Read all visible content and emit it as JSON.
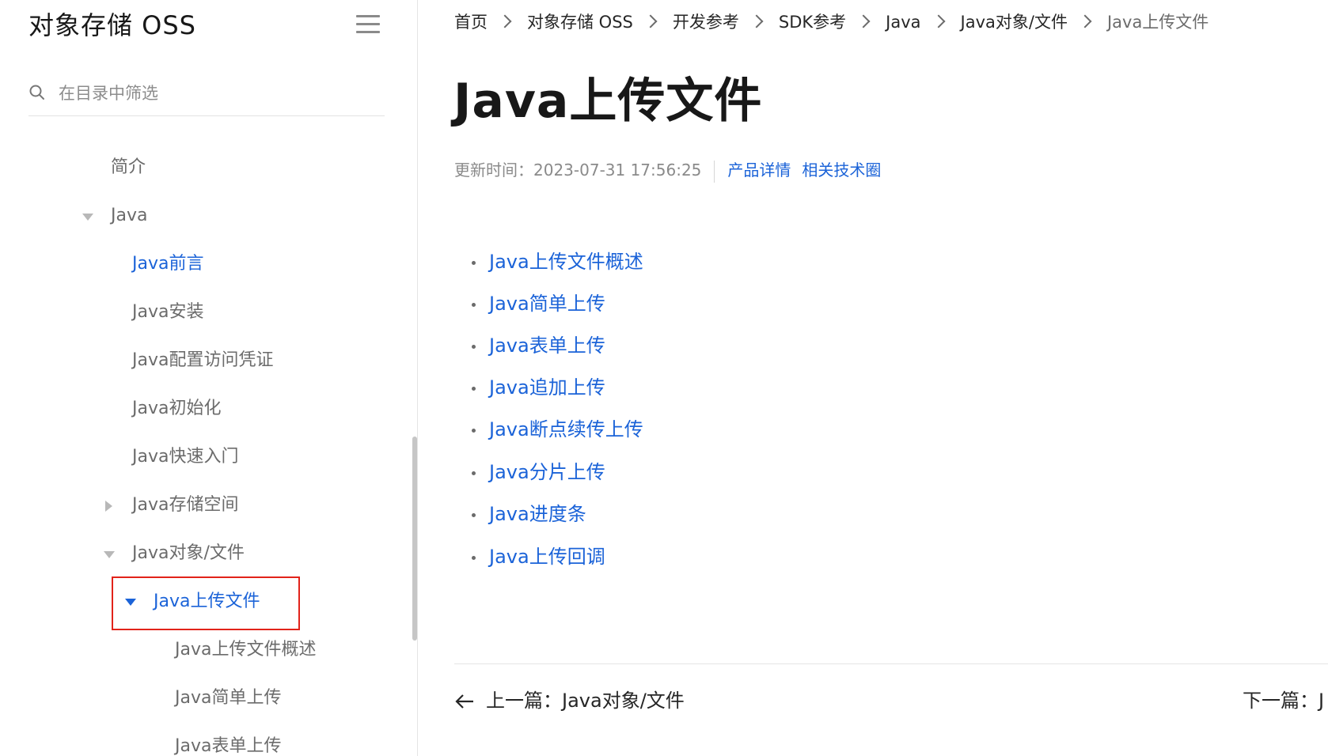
{
  "sidebar": {
    "title": "对象存储 OSS",
    "search_placeholder": "在目录中筛选",
    "items": [
      {
        "label": "简介"
      },
      {
        "label": "Java"
      },
      {
        "label": "Java前言"
      },
      {
        "label": "Java安装"
      },
      {
        "label": "Java配置访问凭证"
      },
      {
        "label": "Java初始化"
      },
      {
        "label": "Java快速入门"
      },
      {
        "label": "Java存储空间"
      },
      {
        "label": "Java对象/文件"
      },
      {
        "label": "Java上传文件"
      },
      {
        "label": "Java上传文件概述"
      },
      {
        "label": "Java简单上传"
      },
      {
        "label": "Java表单上传"
      }
    ]
  },
  "breadcrumb": [
    "首页",
    "对象存储 OSS",
    "开发参考",
    "SDK参考",
    "Java",
    "Java对象/文件",
    "Java上传文件"
  ],
  "page": {
    "title": "Java上传文件",
    "updated": "更新时间：2023-07-31 17:56:25",
    "links": [
      "产品详情",
      "相关技术圈"
    ]
  },
  "toc": [
    "Java上传文件概述",
    "Java简单上传",
    "Java表单上传",
    "Java追加上传",
    "Java断点续传上传",
    "Java分片上传",
    "Java进度条",
    "Java上传回调"
  ],
  "pager": {
    "prev": "上一篇：Java对象/文件",
    "next": "下一篇：J"
  },
  "colors": {
    "link": "#1b63d8",
    "highlight_border": "#e2231a"
  }
}
